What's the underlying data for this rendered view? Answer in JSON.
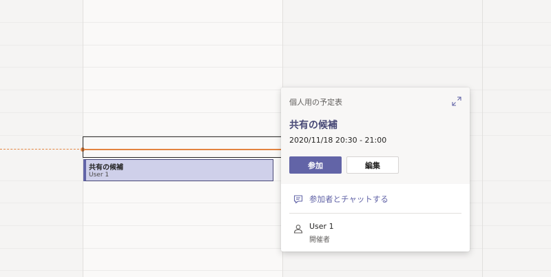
{
  "event": {
    "title": "共有の候補",
    "organizer": "User 1"
  },
  "popup": {
    "calendar_name": "個人用の予定表",
    "title": "共有の候補",
    "time": "2020/11/18 20:30 - 21:00",
    "join_label": "参加",
    "edit_label": "編集",
    "chat_label": "参加者とチャットする",
    "organizer_name": "User 1",
    "organizer_role": "開催者",
    "icons": {
      "expand": "expand-icon",
      "chat": "chat-icon",
      "person": "person-icon"
    }
  },
  "colors": {
    "accent": "#6264a7",
    "event_fill": "#cfd0ea",
    "now_indicator": "#e3833f"
  }
}
